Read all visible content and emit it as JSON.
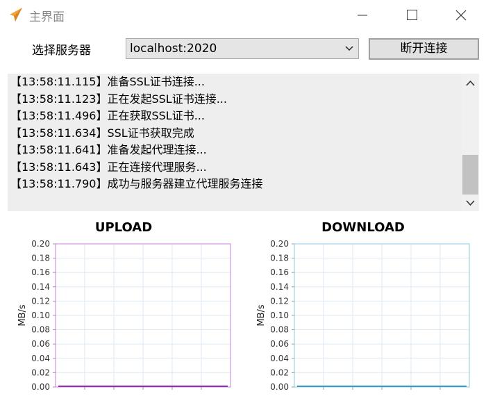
{
  "window": {
    "title": "主界面",
    "icon": "paper-plane-icon",
    "controls": [
      "minimize-icon",
      "maximize-icon",
      "close-icon"
    ]
  },
  "server": {
    "label": "选择服务器",
    "selected": "localhost:2020",
    "button_label": "断开连接"
  },
  "log": {
    "lines": [
      "【13:58:11.115】准备SSL证书连接...",
      "【13:58:11.123】正在发起SSL证书连接...",
      "【13:58:11.496】正在获取SSL证书...",
      "【13:58:11.634】SSL证书获取完成",
      "【13:58:11.641】准备发起代理连接...",
      "【13:58:11.643】正在连接代理服务...",
      "【13:58:11.790】成功与服务器建立代理服务连接"
    ]
  },
  "colors": {
    "upload_line": "#8b2fb0",
    "upload_frame": "#c77de0",
    "download_line": "#3a9ac8",
    "download_frame": "#8cc8e0",
    "grid": "#dde9f5"
  },
  "chart_data": [
    {
      "type": "line",
      "title": "UPLOAD",
      "xlabel": "",
      "ylabel": "MB/s",
      "ylim": [
        0,
        0.2
      ],
      "yticks": [
        "0.00",
        "0.02",
        "0.04",
        "0.06",
        "0.08",
        "0.10",
        "0.12",
        "0.14",
        "0.16",
        "0.18",
        "0.20"
      ],
      "grid": true,
      "series": [
        {
          "values": [
            0,
            0,
            0,
            0,
            0,
            0,
            0,
            0,
            0,
            0,
            0,
            0
          ]
        }
      ]
    },
    {
      "type": "line",
      "title": "DOWNLOAD",
      "xlabel": "",
      "ylabel": "MB/s",
      "ylim": [
        0,
        0.2
      ],
      "yticks": [
        "0.00",
        "0.02",
        "0.04",
        "0.06",
        "0.08",
        "0.10",
        "0.12",
        "0.14",
        "0.16",
        "0.18",
        "0.20"
      ],
      "grid": true,
      "series": [
        {
          "values": [
            0,
            0,
            0,
            0,
            0,
            0,
            0,
            0,
            0,
            0,
            0,
            0
          ]
        }
      ]
    }
  ]
}
